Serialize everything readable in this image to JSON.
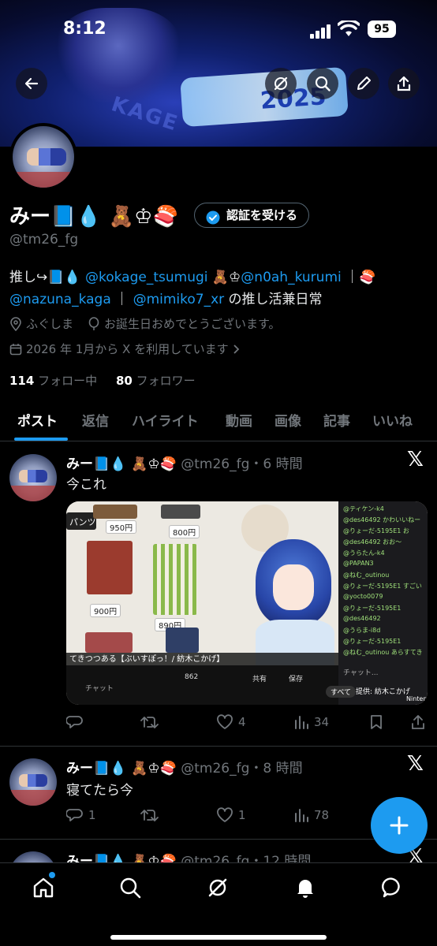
{
  "status": {
    "time": "8:12",
    "battery": "95"
  },
  "profile": {
    "display_name": "みー📘💧 🧸♔🍣",
    "verify_label": "認証を受ける",
    "handle": "@tm26_fg",
    "bio": {
      "prefix": "推し↪︎📘💧",
      "mention1": "@kokage_tsumugi",
      "mid1": " 🧸♔",
      "mention2": "@n0ah_kurumi",
      "sep1": " ｜🍣",
      "mention3": "@nazuna_kaga",
      "sep2": " ｜ ",
      "mention4": "@mimiko7_xr",
      "suffix": " の推し活兼日常"
    },
    "location": "ふぐしま",
    "birthday": "お誕生日おめでとうございます。",
    "joined": "2026 年 1月から X を利用しています",
    "following_count": "114",
    "following_label": "フォロー中",
    "followers_count": "80",
    "followers_label": "フォロワー"
  },
  "tabs": [
    "ポスト",
    "返信",
    "ハイライト",
    "動画",
    "画像",
    "記事",
    "いいね"
  ],
  "posts": [
    {
      "name": "みー📘💧 🧸♔🍣",
      "meta": "@tm26_fg・6 時間",
      "text": "今これ",
      "media": {
        "caption": "てきつつある【ぶいすぽっ！/ 紡木こかげ】",
        "chat_label": "チャット",
        "likes": "862",
        "share": "共有",
        "save": "保存",
        "prices": [
          "950円",
          "800円",
          "900円",
          "890円"
        ],
        "tag": "パンツ",
        "chat_rows": [
          "@ティケン-k4",
          "@des46492 かわいいねー",
          "@りょーだ-5195E1 お",
          "@des46492 おお〜",
          "@うらたん-k4",
          "@PAPAN3",
          "@ねむ_outinou",
          "@りょーだ-5195E1 すごい",
          "@yocto0079",
          "@りょーだ-5195E1",
          "@des46492",
          "@うらま-i8d",
          "@りょーだ-5195E1",
          "@ねむ_outinou あらすてき"
        ],
        "chat_input": "チャット...",
        "chip_all": "すべて",
        "chip_provider": "提供: 紡木こかげ",
        "chip_nintendo": "Ninten"
      },
      "replies": "",
      "reposts": "",
      "likes": "4",
      "views": "34"
    },
    {
      "name": "みー📘💧 🧸♔🍣",
      "meta": "@tm26_fg・8 時間",
      "text": "寝てたら今",
      "replies": "1",
      "reposts": "",
      "likes": "1",
      "views": "78"
    },
    {
      "name": "みー📘💧 🧸♔🍣",
      "meta": "@tm26_fg・12 時間"
    }
  ],
  "colors": {
    "accent": "#1d9bf0",
    "muted": "#71767b",
    "bg": "#000000"
  }
}
